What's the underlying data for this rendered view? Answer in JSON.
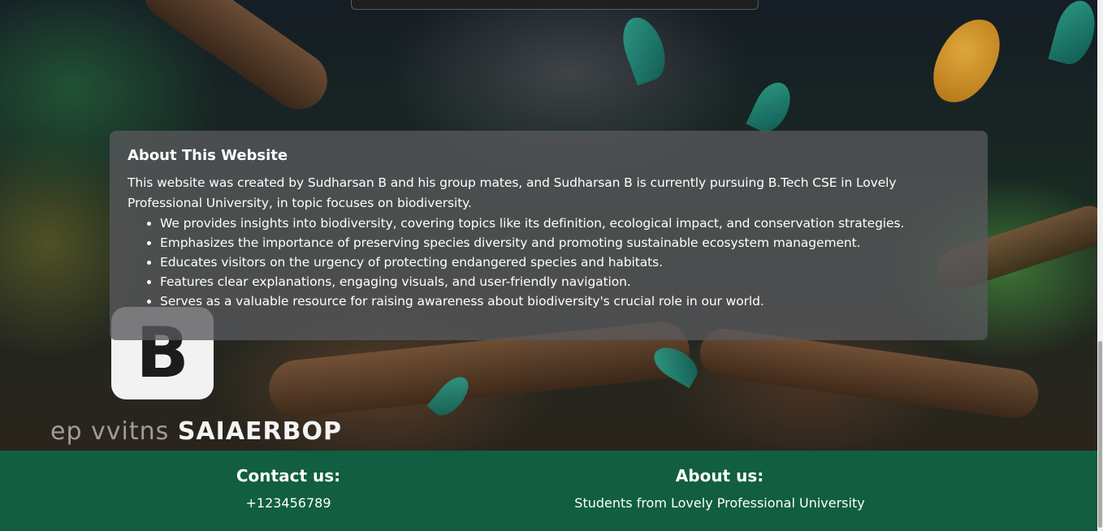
{
  "about": {
    "title": "About This Website",
    "intro": "This website was created by Sudharsan B and his group mates, and Sudharsan B is currently pursuing B.Tech CSE in Lovely Professional University, in topic focuses on biodiversity.",
    "points": [
      "We provides insights into biodiversity, covering topics like its definition, ecological impact, and conservation strategies.",
      "Emphasizes the importance of preserving species diversity and promoting sustainable ecosystem management.",
      "Educates visitors on the urgency of protecting endangered species and habitats.",
      "Features clear explanations, engaging visuals, and user-friendly navigation.",
      "Serves as a valuable resource for raising awareness about biodiversity's crucial role in our world."
    ]
  },
  "logo": {
    "letter": "B",
    "text_faint": "ep vvitns ",
    "text_bright": "SAIAERBOP"
  },
  "footer": {
    "contact": {
      "heading": "Contact us:",
      "value": "+123456789"
    },
    "about": {
      "heading": "About us:",
      "value": "Students from Lovely Professional University"
    }
  },
  "colors": {
    "footer_bg": "#115e41",
    "panel_bg": "rgba(88,88,92,0.78)",
    "text": "#ffffff"
  }
}
